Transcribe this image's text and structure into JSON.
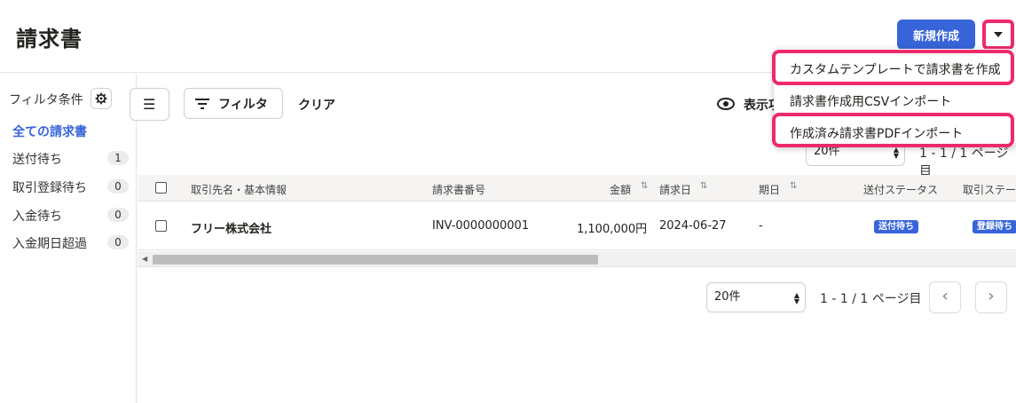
{
  "header": {
    "title": "請求書",
    "new_button": "新規作成"
  },
  "dropdown_menu": {
    "items": [
      "カスタムテンプレートで請求書を作成",
      "請求書作成用CSVインポート",
      "作成済み請求書PDFインポート"
    ]
  },
  "sidebar": {
    "filter_heading": "フィルタ条件",
    "items": [
      {
        "label": "全ての請求書"
      },
      {
        "label": "送付待ち",
        "count": "1"
      },
      {
        "label": "取引登録待ち",
        "count": "0"
      },
      {
        "label": "入金待ち",
        "count": "0"
      },
      {
        "label": "入金期日超過",
        "count": "0"
      }
    ]
  },
  "toolbar": {
    "filter_label": "フィルタ",
    "clear_label": "クリア",
    "display_label": "表示項"
  },
  "pager_top": {
    "per_page": "20件",
    "range_text": "1 - 1 / 1 ページ目"
  },
  "pager_bottom": {
    "per_page": "20件",
    "range_text": "1 - 1 / 1 ページ目"
  },
  "table": {
    "columns": [
      "取引先名・基本情報",
      "請求書番号",
      "金額",
      "請求日",
      "期日",
      "送付ステータス",
      "取引ステー"
    ],
    "rows": [
      {
        "partner": "フリー株式会社",
        "number": "INV-0000000001",
        "amount": "1,100,000円",
        "date": "2024-06-27",
        "due": "-",
        "send_status": "送付待ち",
        "deal_status": "登録待ち"
      }
    ]
  },
  "colors": {
    "accent": "#3764d9",
    "highlight": "#ee2a6b"
  }
}
